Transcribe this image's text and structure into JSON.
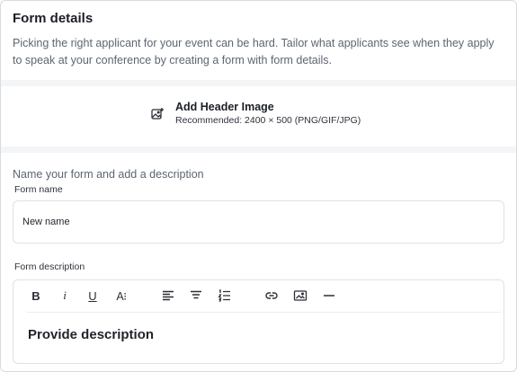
{
  "form": {
    "title": "Form details",
    "subtitle": "Picking the right applicant for your event can be hard. Tailor what applicants see when they apply to speak at your conference by creating a form with form details."
  },
  "header_image": {
    "title": "Add Header Image",
    "recommendation": "Recommended: 2400 × 500 (PNG/GIF/JPG)",
    "icon": "image-add-icon"
  },
  "details": {
    "section_title": "Name your form and add a description",
    "name_label": "Form name",
    "name_value": "New name",
    "description_label": "Form description",
    "description_placeholder": "Provide description"
  },
  "toolbar": {
    "bold": "B",
    "italic": "i",
    "underline": "U",
    "text_size": "A⁝",
    "icons": [
      "bold-icon",
      "italic-icon",
      "underline-icon",
      "text-size-icon",
      "align-left-icon",
      "align-center-icon",
      "ordered-list-icon",
      "link-icon",
      "image-icon",
      "horizontal-rule-icon"
    ]
  }
}
